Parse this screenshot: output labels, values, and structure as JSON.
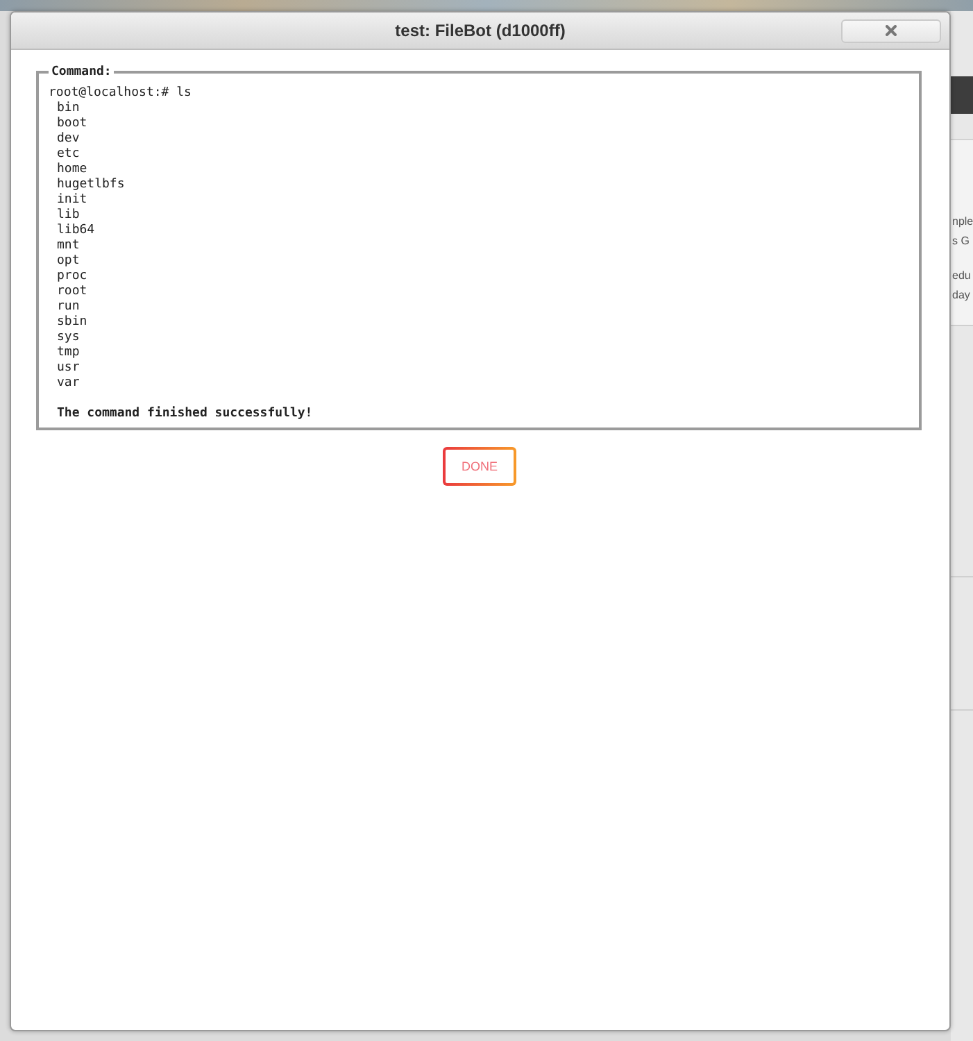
{
  "background": {
    "side_panel": {
      "blocks": [
        {
          "lines": [
            "nple",
            "s G"
          ]
        },
        {
          "lines": [
            "edu",
            "day"
          ]
        }
      ]
    }
  },
  "dialog": {
    "title": "test: FileBot (d1000ff)",
    "command": {
      "legend": "Command:",
      "prompt": "root@localhost:# ls",
      "output": [
        "bin",
        "boot",
        "dev",
        "etc",
        "home",
        "hugetlbfs",
        "init",
        "lib",
        "lib64",
        "mnt",
        "opt",
        "proc",
        "root",
        "run",
        "sbin",
        "sys",
        "tmp",
        "usr",
        "var"
      ],
      "status": "The command finished successfully!"
    },
    "buttons": [
      {
        "label": "DONE"
      }
    ]
  }
}
